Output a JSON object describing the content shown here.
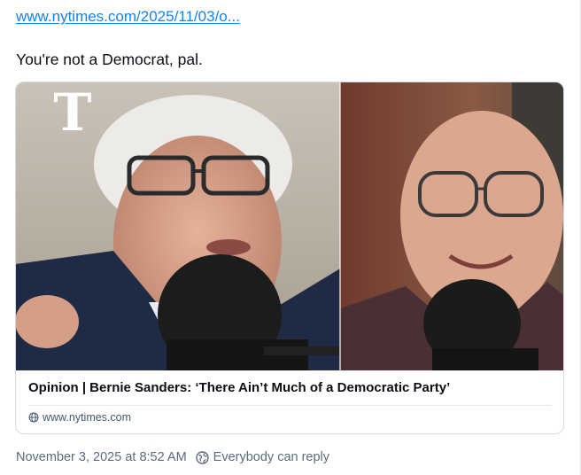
{
  "post": {
    "link_text": "www.nytimes.com/2025/11/03/o...",
    "text": "You're not a Democrat, pal."
  },
  "card": {
    "image_alt": "Bernie Sanders and interviewer at microphones",
    "title": "Opinion | Bernie Sanders: ‘There Ain’t Much of a Democratic Party’",
    "domain": "www.nytimes.com",
    "logo": "T"
  },
  "meta": {
    "timestamp": "November 3, 2025 at 8:52 AM",
    "reply_setting": "Everybody can reply"
  },
  "icons": {
    "domain": "globe-icon",
    "reply": "globe-earth-icon"
  },
  "colors": {
    "link": "#1083fe",
    "text": "#0b0f14",
    "muted": "#5b6b7c"
  }
}
